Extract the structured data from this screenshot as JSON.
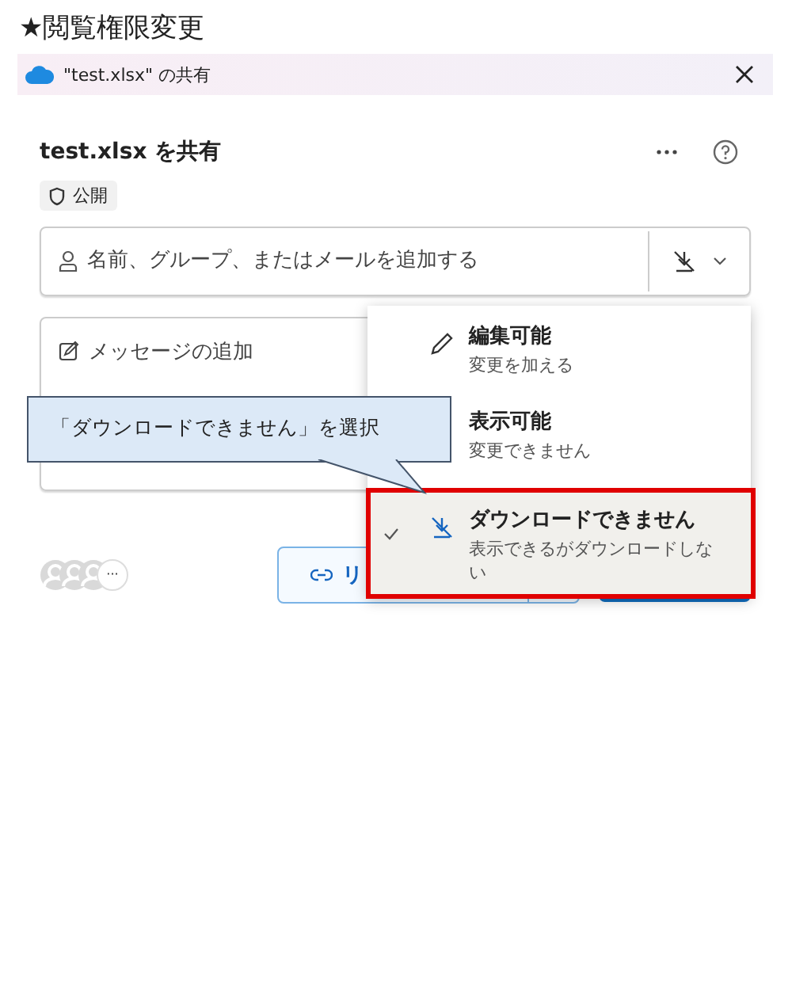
{
  "heading": "★閲覧権限変更",
  "dialog": {
    "title": "\"test.xlsx\" の共有",
    "share_title": "test.xlsx を共有",
    "badge": "公開",
    "recipient_field": {
      "placeholder": "名前、グループ、またはメールを追加する"
    },
    "message_field": {
      "placeholder": "メッセージの追加"
    },
    "footer": {
      "avatars_more": "···",
      "copy_link_button": "リ"
    },
    "permission_menu": {
      "items": [
        {
          "kind": "edit",
          "title": "編集可能",
          "subtitle": "変更を加える",
          "selected": false
        },
        {
          "kind": "view",
          "title": "表示可能",
          "subtitle": "変更できません",
          "selected": false
        },
        {
          "kind": "no_download",
          "title": "ダウンロードできません",
          "subtitle": "表示できるがダウンロードしない",
          "selected": true
        }
      ]
    }
  },
  "callout": {
    "text": "「ダウンロードできません」を選択"
  }
}
